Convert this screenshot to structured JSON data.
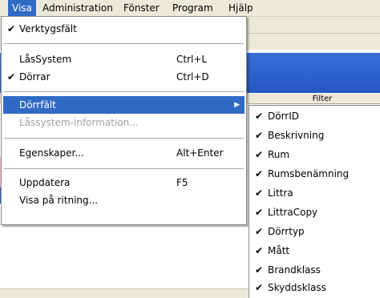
{
  "menubar": {
    "items": [
      {
        "label": "Visa"
      },
      {
        "label": "Administration"
      },
      {
        "label": "Fönster"
      },
      {
        "label": "Program"
      },
      {
        "label": "Hjälp"
      }
    ]
  },
  "background": {
    "filter_label": "Filter"
  },
  "visa_menu": {
    "toolbar": {
      "check": "✔",
      "label": "Verktygsfält"
    },
    "lock_system": {
      "label": "LåsSystem",
      "shortcut": "Ctrl+L"
    },
    "doors": {
      "check": "✔",
      "label": "Dörrar",
      "shortcut": "Ctrl+D"
    },
    "door_fields": {
      "label": "Dörrfält",
      "arrow": "▶"
    },
    "lock_system_info": {
      "label": "Låssystem-information..."
    },
    "properties": {
      "label": "Egenskaper...",
      "shortcut": "Alt+Enter"
    },
    "refresh": {
      "label": "Uppdatera",
      "shortcut": "F5"
    },
    "show_on_drawing": {
      "label": "Visa på ritning..."
    }
  },
  "door_fields_submenu": {
    "check": "✔",
    "items": [
      {
        "label": "DörrID"
      },
      {
        "label": "Beskrivning"
      },
      {
        "label": "Rum"
      },
      {
        "label": "Rumsbenämning"
      },
      {
        "label": "Littra"
      },
      {
        "label": "LittraCopy"
      },
      {
        "label": "Dörrtyp"
      },
      {
        "label": "Mått"
      },
      {
        "label": "Brandklass"
      },
      {
        "label": "Skyddsklass"
      }
    ]
  },
  "colors": {
    "highlight": "#316ac5",
    "menubar_bg": "#ece9d8",
    "disabled_text": "#a0a0a0"
  }
}
